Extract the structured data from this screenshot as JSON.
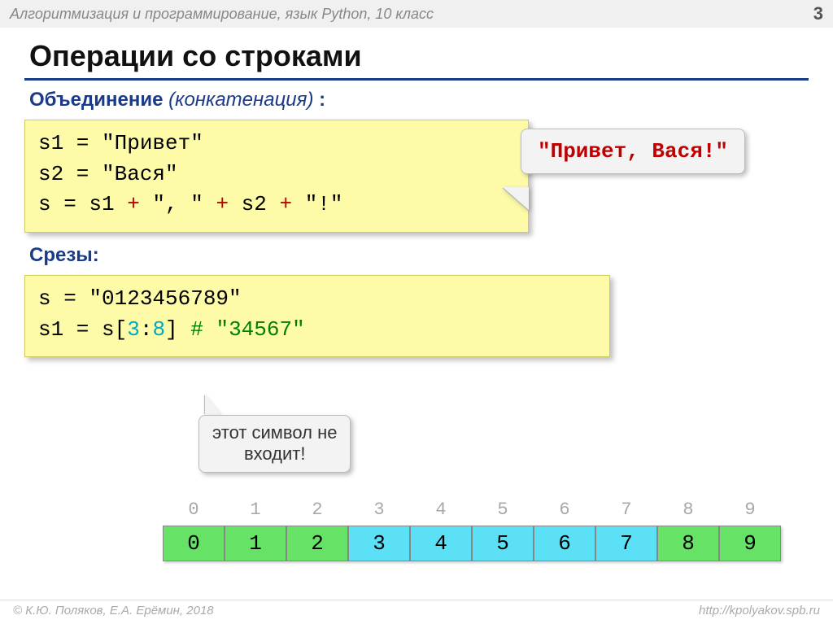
{
  "header": {
    "breadcrumb": "Алгоритмизация и программирование, язык Python, 10 класс",
    "page_number": "3"
  },
  "title": "Операции со строками",
  "section1": {
    "label_bold": "Объединение",
    "label_italic": "(конкатенация)",
    "colon": " :",
    "code_lines": [
      "s1 = \"Привет\"",
      "s2 = \"Вася\"",
      "s  = s1 + \", \" + s2 + \"!\""
    ],
    "callout": "\"Привет, Вася!\""
  },
  "section2": {
    "label": "Срезы",
    "colon": ":",
    "code": {
      "line1": "s = \"0123456789\"",
      "line2_prefix": "s1 = s[",
      "line2_a": "3",
      "line2_mid": ":",
      "line2_b": "8",
      "line2_suffix": "]",
      "line2_pad": "           ",
      "comment": "# \"34567\""
    },
    "callout_lines": [
      "этот символ не",
      "входит!"
    ]
  },
  "table": {
    "indices": [
      "0",
      "1",
      "2",
      "3",
      "4",
      "5",
      "6",
      "7",
      "8",
      "9"
    ],
    "cells": [
      {
        "v": "0",
        "c": "green"
      },
      {
        "v": "1",
        "c": "green"
      },
      {
        "v": "2",
        "c": "green"
      },
      {
        "v": "3",
        "c": "cyan"
      },
      {
        "v": "4",
        "c": "cyan"
      },
      {
        "v": "5",
        "c": "cyan"
      },
      {
        "v": "6",
        "c": "cyan"
      },
      {
        "v": "7",
        "c": "cyan"
      },
      {
        "v": "8",
        "c": "green"
      },
      {
        "v": "9",
        "c": "green"
      }
    ]
  },
  "footer": {
    "left": "© К.Ю. Поляков, Е.А. Ерёмин, 2018",
    "right": "http://kpolyakov.spb.ru"
  }
}
